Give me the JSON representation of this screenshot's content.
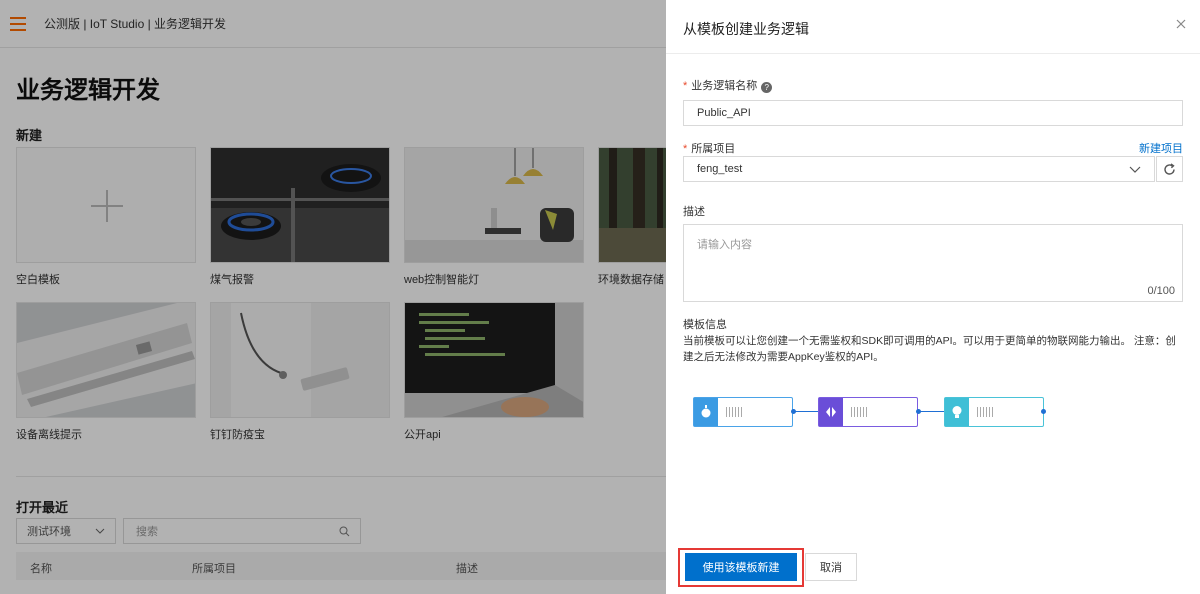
{
  "topbar": {
    "title": "公测版 | IoT Studio | 业务逻辑开发"
  },
  "page": {
    "title": "业务逻辑开发",
    "section_new": "新建",
    "section_recent": "打开最近"
  },
  "templates": [
    {
      "label": "空白模板"
    },
    {
      "label": "煤气报警"
    },
    {
      "label": "web控制智能灯"
    },
    {
      "label": "环境数据存储"
    },
    {
      "label": "设备离线提示"
    },
    {
      "label": "钉钉防疫宝"
    },
    {
      "label": "公开api"
    }
  ],
  "recent": {
    "env_select": "测试环境",
    "search_placeholder": "搜索",
    "columns": [
      "名称",
      "所属项目",
      "描述"
    ]
  },
  "drawer": {
    "title": "从模板创建业务逻辑",
    "name_label": "业务逻辑名称",
    "name_value": "Public_API",
    "project_label": "所属项目",
    "new_project_link": "新建项目",
    "project_value": "feng_test",
    "desc_label": "描述",
    "desc_placeholder": "请输入内容",
    "desc_count": "0/100",
    "info_title": "模板信息",
    "info_text": "当前模板可以让您创建一个无需鉴权和SDK即可调用的API。可以用于更简单的物联网能力输出。 注意：创建之后无法修改为需要AppKey鉴权的API。",
    "create_button": "使用该模板新建",
    "cancel_button": "取消"
  },
  "colors": {
    "accent": "#0070cc",
    "brand_orange": "#ff6a00",
    "highlight": "#e53935"
  }
}
